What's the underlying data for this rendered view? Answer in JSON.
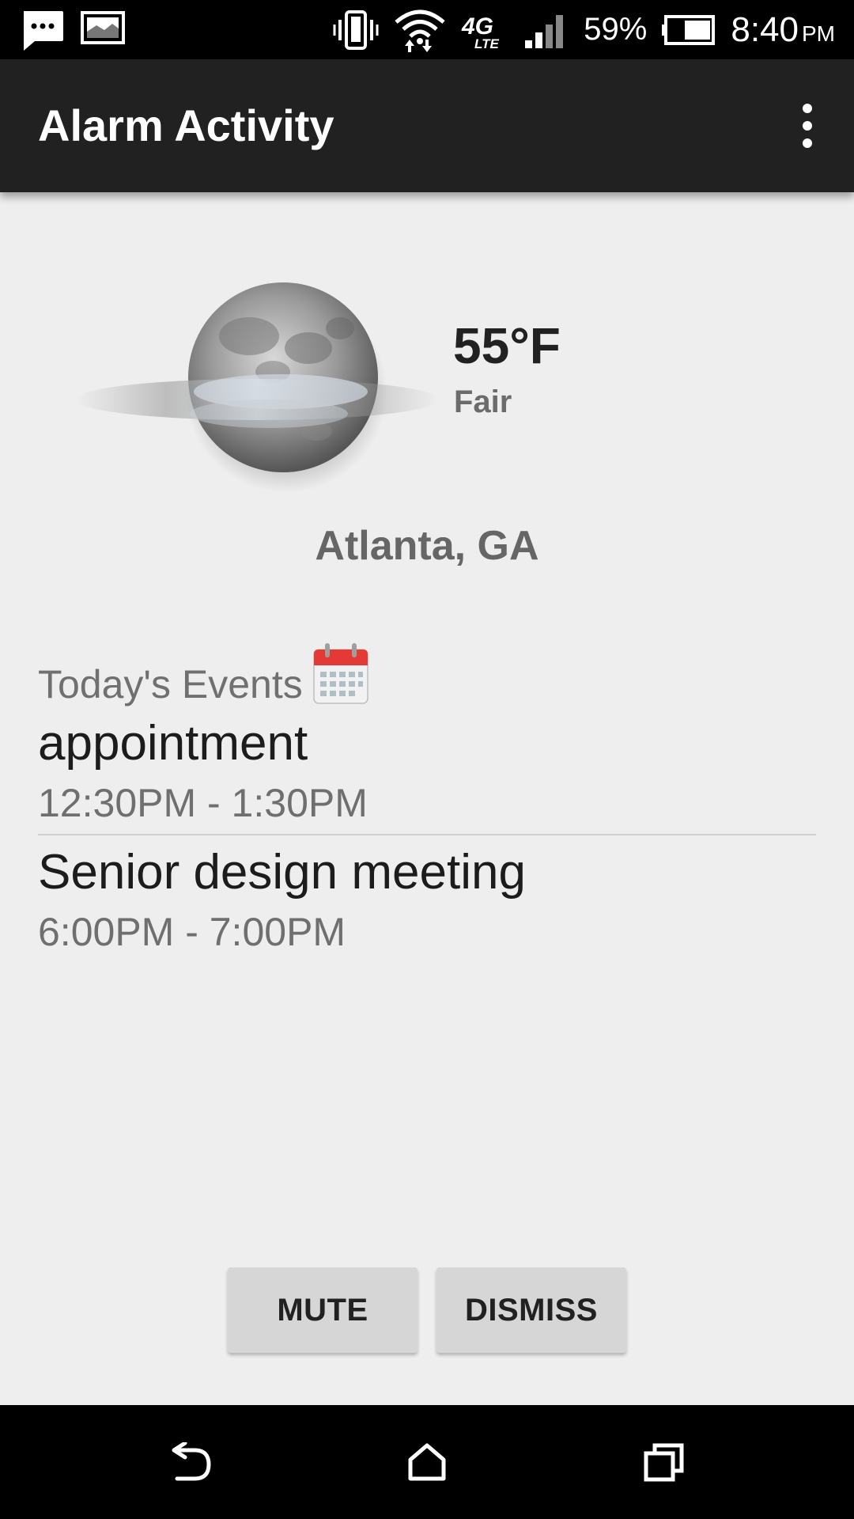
{
  "status_bar": {
    "battery_percent": "59%",
    "time": "8:40",
    "time_suffix": "PM",
    "icons": [
      "message-icon",
      "image-icon",
      "vibrate-icon",
      "wifi-icon",
      "4g-lte-icon",
      "signal-icon",
      "battery-icon"
    ]
  },
  "app_bar": {
    "title": "Alarm Activity",
    "menu_icon": "overflow-menu-icon"
  },
  "weather": {
    "temperature": "55°F",
    "condition": "Fair",
    "location": "Atlanta, GA",
    "icon": "moon-fog-icon"
  },
  "events": {
    "title": "Today's Events",
    "icon": "calendar-icon",
    "items": [
      {
        "name": "appointment",
        "time": "12:30PM - 1:30PM"
      },
      {
        "name": "Senior design meeting",
        "time": "6:00PM - 7:00PM"
      }
    ]
  },
  "buttons": {
    "mute_label": "MUTE",
    "dismiss_label": "DISMISS"
  },
  "nav_bar": {
    "icons": [
      "back-icon",
      "home-icon",
      "recents-icon"
    ]
  }
}
